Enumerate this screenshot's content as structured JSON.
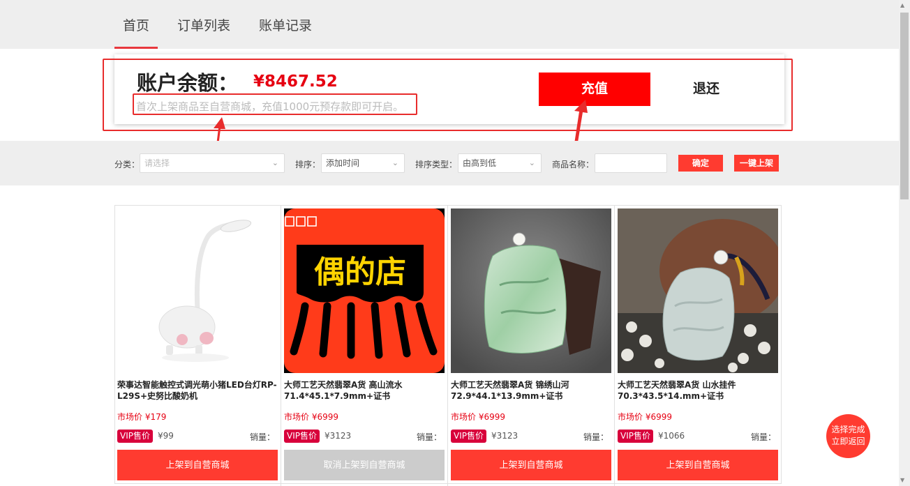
{
  "nav": {
    "tabs": [
      {
        "label": "首页",
        "active": true
      },
      {
        "label": "订单列表",
        "active": false
      },
      {
        "label": "账单记录",
        "active": false
      }
    ]
  },
  "account": {
    "balance_label": "账户余额：",
    "balance_value": "¥8467.52",
    "hint": "首次上架商品至自营商城，充值1000元预存款即可开启。",
    "recharge_label": "充值",
    "refund_label": "退还"
  },
  "filters": {
    "category_label": "分类：",
    "category_placeholder": "请选择",
    "sort_label": "排序：",
    "sort_value": "添加时间",
    "sort_type_label": "排序类型：",
    "sort_type_value": "由高到低",
    "name_label": "商品名称：",
    "confirm_label": "确定",
    "one_click_label": "一键上架"
  },
  "products": [
    {
      "title": "荣事达智能触控式调光萌小猪LED台灯RP-L29S+史努比酸奶机",
      "market_price": "市场价 ¥179",
      "vip_badge": "VIP售价",
      "vip_price": "¥99",
      "sales_label": "销量：",
      "button": "上架到自营商城",
      "button_state": "active"
    },
    {
      "title": "大师工艺天然翡翠A货 高山流水 71.4*45.1*7.9mm+证书",
      "market_price": "市场价 ¥6999",
      "vip_badge": "VIP售价",
      "vip_price": "¥3123",
      "sales_label": "销量：",
      "button": "取消上架到自营商城",
      "button_state": "disabled",
      "image_text": "偶的店"
    },
    {
      "title": "大师工艺天然翡翠A货 锦绣山河 72.9*44.1*13.9mm+证书",
      "market_price": "市场价 ¥6999",
      "vip_badge": "VIP售价",
      "vip_price": "¥3123",
      "sales_label": "销量：",
      "button": "上架到自营商城",
      "button_state": "active"
    },
    {
      "title": "大师工艺天然翡翠A货 山水挂件 70.3*43.5*14.mm+证书",
      "market_price": "市场价 ¥6999",
      "vip_badge": "VIP售价",
      "vip_price": "¥1066",
      "sales_label": "销量：",
      "button": "上架到自营商城",
      "button_state": "active"
    }
  ],
  "float_button": {
    "line1": "选择完成",
    "line2": "立即返回"
  },
  "colors": {
    "accent": "#ff3b30",
    "recharge": "#ff0000",
    "price": "#e60012",
    "vip": "#d8003b",
    "annotation": "#e82c2c"
  }
}
